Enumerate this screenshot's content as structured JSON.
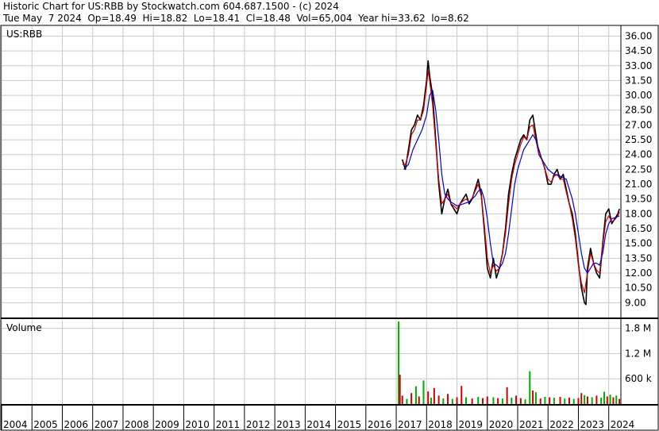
{
  "header": {
    "line1": "Historic Chart for US:RBB by Stockwatch.com 604.687.1500 - (c) 2024",
    "line2": "Tue May  7 2024  Op=18.49  Hi=18.82  Lo=18.41  Cl=18.48  Vol=65,004  Year hi=33.62  lo=8.62"
  },
  "chart_data": {
    "type": "line",
    "symbol": "US:RBB",
    "price_panel": {
      "label": "US:RBB",
      "ylim": [
        7.5,
        37.0
      ],
      "y_ticks": [
        "36.00",
        "34.50",
        "33.00",
        "31.50",
        "30.00",
        "28.50",
        "27.00",
        "25.50",
        "24.00",
        "22.50",
        "21.00",
        "19.50",
        "18.00",
        "16.50",
        "15.00",
        "13.50",
        "12.00",
        "10.50",
        "9.00"
      ],
      "series": [
        {
          "color": "#000000",
          "x": [
            2017.2,
            2017.3,
            2017.4,
            2017.5,
            2017.6,
            2017.7,
            2017.8,
            2017.9,
            2018.0,
            2018.05,
            2018.1,
            2018.2,
            2018.3,
            2018.4,
            2018.5,
            2018.6,
            2018.7,
            2018.8,
            2018.9,
            2019.0,
            2019.1,
            2019.2,
            2019.3,
            2019.4,
            2019.5,
            2019.6,
            2019.7,
            2019.8,
            2019.9,
            2020.0,
            2020.1,
            2020.15,
            2020.2,
            2020.3,
            2020.4,
            2020.5,
            2020.6,
            2020.7,
            2020.8,
            2020.9,
            2021.0,
            2021.1,
            2021.2,
            2021.3,
            2021.4,
            2021.5,
            2021.6,
            2021.7,
            2021.8,
            2021.9,
            2022.0,
            2022.1,
            2022.2,
            2022.3,
            2022.4,
            2022.5,
            2022.6,
            2022.7,
            2022.8,
            2022.9,
            2023.0,
            2023.1,
            2023.2,
            2023.25,
            2023.3,
            2023.4,
            2023.5,
            2023.6,
            2023.7,
            2023.8,
            2023.9,
            2024.0,
            2024.1,
            2024.2,
            2024.3,
            2024.35
          ],
          "y": [
            23.5,
            22.5,
            24.5,
            26.5,
            27.0,
            28.0,
            27.5,
            29.0,
            31.5,
            33.5,
            32.0,
            30.0,
            25.5,
            21.0,
            18.0,
            19.5,
            20.5,
            19.0,
            18.5,
            18.0,
            19.0,
            19.5,
            20.0,
            19.0,
            19.5,
            20.5,
            21.5,
            20.0,
            16.5,
            12.5,
            11.5,
            12.5,
            13.5,
            11.5,
            12.5,
            14.0,
            16.5,
            20.0,
            22.0,
            23.5,
            24.5,
            25.5,
            26.0,
            25.5,
            27.5,
            28.0,
            26.0,
            24.0,
            23.5,
            22.5,
            21.0,
            21.0,
            22.0,
            22.5,
            21.5,
            22.0,
            20.5,
            19.0,
            18.0,
            16.0,
            13.0,
            10.5,
            9.0,
            8.8,
            12.5,
            14.5,
            13.0,
            12.0,
            11.5,
            15.0,
            18.0,
            18.5,
            17.0,
            17.5,
            18.0,
            18.5
          ]
        },
        {
          "color": "#cc0000",
          "x": [
            2017.2,
            2017.3,
            2017.4,
            2017.5,
            2017.6,
            2017.7,
            2017.8,
            2017.9,
            2018.0,
            2018.05,
            2018.1,
            2018.2,
            2018.3,
            2018.4,
            2018.5,
            2018.6,
            2018.7,
            2018.8,
            2018.9,
            2019.0,
            2019.1,
            2019.2,
            2019.3,
            2019.4,
            2019.5,
            2019.6,
            2019.7,
            2019.8,
            2019.9,
            2020.0,
            2020.1,
            2020.2,
            2020.3,
            2020.4,
            2020.5,
            2020.6,
            2020.7,
            2020.8,
            2020.9,
            2021.0,
            2021.1,
            2021.2,
            2021.3,
            2021.4,
            2021.5,
            2021.6,
            2021.7,
            2021.8,
            2021.9,
            2022.0,
            2022.1,
            2022.2,
            2022.3,
            2022.4,
            2022.5,
            2022.6,
            2022.7,
            2022.8,
            2022.9,
            2023.0,
            2023.1,
            2023.2,
            2023.3,
            2023.4,
            2023.5,
            2023.6,
            2023.7,
            2023.8,
            2023.9,
            2024.0,
            2024.1,
            2024.2,
            2024.3,
            2024.35
          ],
          "y": [
            23.0,
            23.0,
            24.0,
            26.0,
            26.5,
            27.5,
            27.5,
            28.5,
            31.0,
            32.5,
            31.5,
            29.0,
            25.0,
            21.5,
            19.0,
            19.5,
            20.0,
            19.0,
            18.8,
            18.5,
            19.0,
            19.3,
            19.5,
            19.2,
            19.6,
            20.3,
            21.0,
            19.8,
            17.0,
            13.5,
            12.0,
            12.8,
            12.2,
            12.5,
            14.0,
            16.0,
            19.0,
            21.5,
            23.0,
            24.0,
            25.0,
            25.8,
            25.5,
            26.8,
            27.0,
            25.5,
            24.0,
            23.5,
            22.5,
            21.5,
            21.2,
            21.8,
            22.0,
            21.5,
            21.5,
            20.2,
            19.0,
            17.5,
            15.5,
            12.8,
            11.0,
            10.0,
            12.0,
            14.0,
            13.0,
            12.3,
            12.0,
            14.8,
            17.2,
            17.8,
            17.2,
            17.4,
            17.8,
            18.2
          ]
        },
        {
          "color": "#0000cc",
          "x": [
            2017.25,
            2017.4,
            2017.55,
            2017.7,
            2017.85,
            2018.0,
            2018.1,
            2018.2,
            2018.3,
            2018.4,
            2018.5,
            2018.6,
            2018.7,
            2018.8,
            2018.9,
            2019.0,
            2019.2,
            2019.4,
            2019.6,
            2019.7,
            2019.8,
            2019.9,
            2020.0,
            2020.1,
            2020.2,
            2020.3,
            2020.4,
            2020.5,
            2020.6,
            2020.7,
            2020.8,
            2020.9,
            2021.0,
            2021.2,
            2021.4,
            2021.5,
            2021.6,
            2021.7,
            2021.8,
            2021.9,
            2022.0,
            2022.2,
            2022.4,
            2022.6,
            2022.7,
            2022.8,
            2022.9,
            2023.0,
            2023.1,
            2023.2,
            2023.3,
            2023.4,
            2023.5,
            2023.6,
            2023.7,
            2023.8,
            2023.9,
            2024.0,
            2024.1,
            2024.2,
            2024.35
          ],
          "y": [
            22.5,
            23.0,
            24.5,
            25.5,
            26.5,
            28.0,
            30.0,
            30.5,
            28.5,
            25.5,
            22.0,
            20.0,
            19.5,
            19.2,
            19.0,
            18.8,
            19.0,
            19.2,
            19.8,
            20.3,
            20.5,
            19.5,
            17.5,
            15.0,
            13.0,
            12.8,
            12.5,
            13.0,
            14.0,
            16.0,
            18.5,
            21.0,
            22.5,
            24.5,
            25.5,
            26.0,
            25.5,
            24.5,
            23.5,
            23.0,
            22.5,
            22.0,
            21.8,
            21.5,
            20.5,
            19.5,
            18.0,
            16.0,
            14.0,
            12.5,
            12.0,
            12.5,
            13.0,
            13.0,
            12.8,
            14.0,
            16.0,
            17.0,
            17.5,
            17.6,
            17.8
          ]
        }
      ]
    },
    "volume_panel": {
      "label": "Volume",
      "ylim": [
        0,
        2000000
      ],
      "y_ticks": [
        "1.8 M",
        "1.2 M",
        "600 k"
      ],
      "bars": [
        {
          "x": 2017.08,
          "v": 1960000,
          "color": "#00aa00"
        },
        {
          "x": 2017.12,
          "v": 700000,
          "color": "#cc0000"
        },
        {
          "x": 2017.2,
          "v": 200000,
          "color": "#cc0000"
        },
        {
          "x": 2017.35,
          "v": 120000,
          "color": "#00aa00"
        },
        {
          "x": 2017.5,
          "v": 260000,
          "color": "#cc0000"
        },
        {
          "x": 2017.65,
          "v": 420000,
          "color": "#00aa00"
        },
        {
          "x": 2017.75,
          "v": 180000,
          "color": "#cc0000"
        },
        {
          "x": 2017.9,
          "v": 560000,
          "color": "#00aa00"
        },
        {
          "x": 2018.05,
          "v": 300000,
          "color": "#cc0000"
        },
        {
          "x": 2018.15,
          "v": 150000,
          "color": "#00aa00"
        },
        {
          "x": 2018.25,
          "v": 380000,
          "color": "#cc0000"
        },
        {
          "x": 2018.4,
          "v": 200000,
          "color": "#cc0000"
        },
        {
          "x": 2018.55,
          "v": 130000,
          "color": "#00aa00"
        },
        {
          "x": 2018.7,
          "v": 240000,
          "color": "#cc0000"
        },
        {
          "x": 2018.85,
          "v": 120000,
          "color": "#00aa00"
        },
        {
          "x": 2019.0,
          "v": 160000,
          "color": "#cc0000"
        },
        {
          "x": 2019.15,
          "v": 430000,
          "color": "#cc0000"
        },
        {
          "x": 2019.3,
          "v": 160000,
          "color": "#00aa00"
        },
        {
          "x": 2019.5,
          "v": 130000,
          "color": "#cc0000"
        },
        {
          "x": 2019.7,
          "v": 170000,
          "color": "#00aa00"
        },
        {
          "x": 2019.85,
          "v": 140000,
          "color": "#cc0000"
        },
        {
          "x": 2020.0,
          "v": 180000,
          "color": "#cc0000"
        },
        {
          "x": 2020.2,
          "v": 160000,
          "color": "#00aa00"
        },
        {
          "x": 2020.35,
          "v": 140000,
          "color": "#cc0000"
        },
        {
          "x": 2020.5,
          "v": 130000,
          "color": "#00aa00"
        },
        {
          "x": 2020.65,
          "v": 400000,
          "color": "#cc0000"
        },
        {
          "x": 2020.8,
          "v": 150000,
          "color": "#00aa00"
        },
        {
          "x": 2020.95,
          "v": 200000,
          "color": "#cc0000"
        },
        {
          "x": 2021.1,
          "v": 140000,
          "color": "#cc0000"
        },
        {
          "x": 2021.25,
          "v": 110000,
          "color": "#00aa00"
        },
        {
          "x": 2021.4,
          "v": 780000,
          "color": "#00aa00"
        },
        {
          "x": 2021.5,
          "v": 320000,
          "color": "#cc0000"
        },
        {
          "x": 2021.6,
          "v": 280000,
          "color": "#00aa00"
        },
        {
          "x": 2021.75,
          "v": 130000,
          "color": "#cc0000"
        },
        {
          "x": 2021.9,
          "v": 170000,
          "color": "#00aa00"
        },
        {
          "x": 2022.05,
          "v": 160000,
          "color": "#cc0000"
        },
        {
          "x": 2022.2,
          "v": 150000,
          "color": "#00aa00"
        },
        {
          "x": 2022.4,
          "v": 170000,
          "color": "#cc0000"
        },
        {
          "x": 2022.55,
          "v": 130000,
          "color": "#00aa00"
        },
        {
          "x": 2022.7,
          "v": 150000,
          "color": "#cc0000"
        },
        {
          "x": 2022.85,
          "v": 120000,
          "color": "#00aa00"
        },
        {
          "x": 2023.0,
          "v": 140000,
          "color": "#cc0000"
        },
        {
          "x": 2023.1,
          "v": 260000,
          "color": "#cc0000"
        },
        {
          "x": 2023.2,
          "v": 210000,
          "color": "#00aa00"
        },
        {
          "x": 2023.3,
          "v": 180000,
          "color": "#cc0000"
        },
        {
          "x": 2023.45,
          "v": 160000,
          "color": "#00aa00"
        },
        {
          "x": 2023.6,
          "v": 200000,
          "color": "#cc0000"
        },
        {
          "x": 2023.75,
          "v": 150000,
          "color": "#00aa00"
        },
        {
          "x": 2023.85,
          "v": 290000,
          "color": "#00aa00"
        },
        {
          "x": 2023.95,
          "v": 180000,
          "color": "#cc0000"
        },
        {
          "x": 2024.05,
          "v": 220000,
          "color": "#00aa00"
        },
        {
          "x": 2024.15,
          "v": 160000,
          "color": "#cc0000"
        },
        {
          "x": 2024.25,
          "v": 200000,
          "color": "#00aa00"
        },
        {
          "x": 2024.35,
          "v": 120000,
          "color": "#cc0000"
        }
      ]
    },
    "x_axis": {
      "xlim": [
        2004,
        2024.4
      ],
      "tick_labels": [
        "2004",
        "2005",
        "2006",
        "2007",
        "2008",
        "2009",
        "2010",
        "2011",
        "2012",
        "2013",
        "2014",
        "2015",
        "2016",
        "2017",
        "2018",
        "2019",
        "2020",
        "2021",
        "2022",
        "2023",
        "2024"
      ],
      "tick_values": [
        2004,
        2005,
        2006,
        2007,
        2008,
        2009,
        2010,
        2011,
        2012,
        2013,
        2014,
        2015,
        2016,
        2017,
        2018,
        2019,
        2020,
        2021,
        2022,
        2023,
        2024
      ]
    },
    "grid": true,
    "colors": {
      "price": "#000000",
      "ma_short": "#cc0000",
      "ma_long": "#0000cc",
      "volume_up": "#00aa00",
      "volume_down": "#cc0000",
      "grid": "#c8c8c8"
    }
  }
}
